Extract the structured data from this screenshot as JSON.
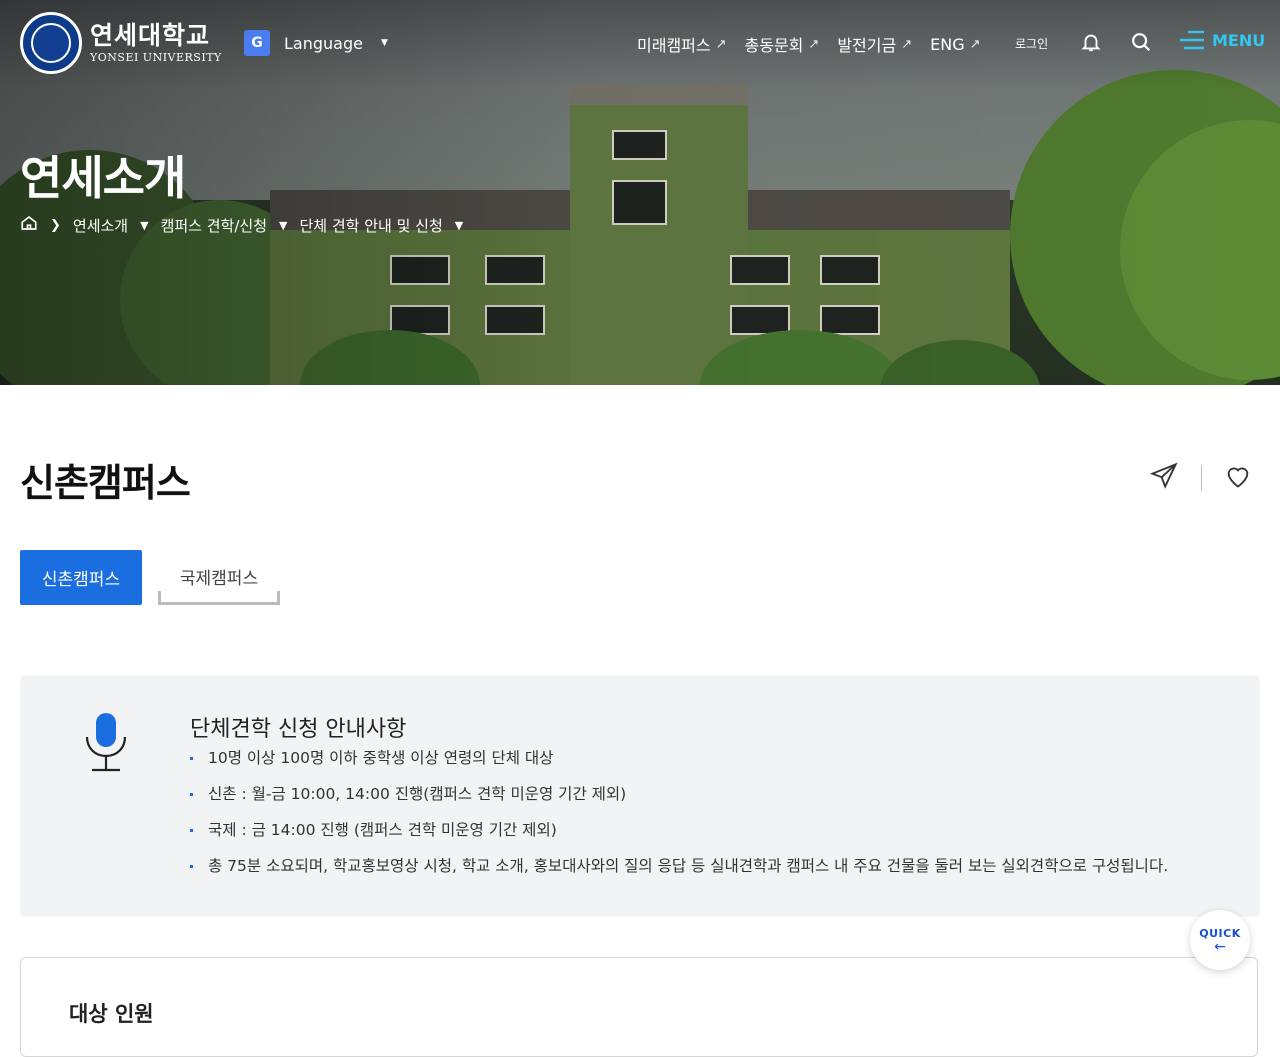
{
  "header": {
    "logo_ko": "연세대학교",
    "logo_en": "YONSEI UNIVERSITY",
    "language_label": "Language",
    "nav": [
      {
        "label": "미래캠퍼스"
      },
      {
        "label": "총동문회"
      },
      {
        "label": "발전기금"
      },
      {
        "label": "ENG"
      }
    ],
    "login_label": "로그인",
    "menu_label": "MENU"
  },
  "hero": {
    "title": "연세소개",
    "breadcrumb": [
      "연세소개",
      "캠퍼스 견학/신청",
      "단체 견학 안내 및 신청"
    ]
  },
  "main": {
    "title": "신촌캠퍼스",
    "tabs": [
      {
        "label": "신촌캠퍼스",
        "active": true
      },
      {
        "label": "국제캠퍼스",
        "active": false
      }
    ],
    "notice": {
      "title": "단체견학 신청 안내사항",
      "items": [
        "10명 이상 100명 이하 중학생 이상 연령의 단체 대상",
        "신촌 : 월-금 10:00, 14:00 진행(캠퍼스 견학 미운영 기간 제외)",
        "국제 : 금 14:00 진행 (캠퍼스 견학 미운영 기간 제외)",
        "총 75분 소요되며, 학교홍보영상 시청, 학교 소개, 홍보대사와의 질의 응답 등 실내견학과 캠퍼스 내 주요 건물을 둘러 보는 실외견학으로 구성됩니다."
      ]
    },
    "panel_title": "대상 인원"
  },
  "quick": {
    "label": "QUICK"
  },
  "colors": {
    "accent": "#1a6ee0",
    "menu": "#35c6f0",
    "notice_bg": "#f2f3f5"
  }
}
